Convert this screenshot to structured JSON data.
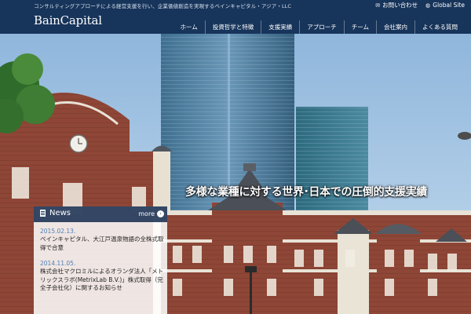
{
  "header": {
    "tagline": "コンサルティングアプローチによる経営支援を行い、企業価値創造を実現するベインキャピタル・アジア・LLC",
    "logo": "BainCapital",
    "links": [
      {
        "icon": "envelope-icon",
        "label": "お問い合わせ"
      },
      {
        "icon": "globe-icon",
        "label": "Global Site"
      }
    ]
  },
  "nav": {
    "items": [
      "ホーム",
      "投資哲学と特徴",
      "支援実績",
      "アプローチ",
      "チーム",
      "会社案内",
      "よくある質問"
    ]
  },
  "hero": {
    "caption": "多様な業種に対する世界･日本での圧倒的支援実績"
  },
  "news": {
    "title": "News",
    "more": "more",
    "items": [
      {
        "date": "2015.02.13.",
        "text": "ベインキャピタル、大江戸温泉物語の全株式取得で合意"
      },
      {
        "date": "2014.11.05.",
        "text": "株式会社マクロミルによるオランダ法人「メトリックスラボ(MetrixLab B.V.)」株式取得（完全子会社化）に関するお知らせ"
      }
    ]
  },
  "colors": {
    "header_bg": "#17345a",
    "news_head_bg": "#243858",
    "date_color": "#4d7fb8"
  }
}
